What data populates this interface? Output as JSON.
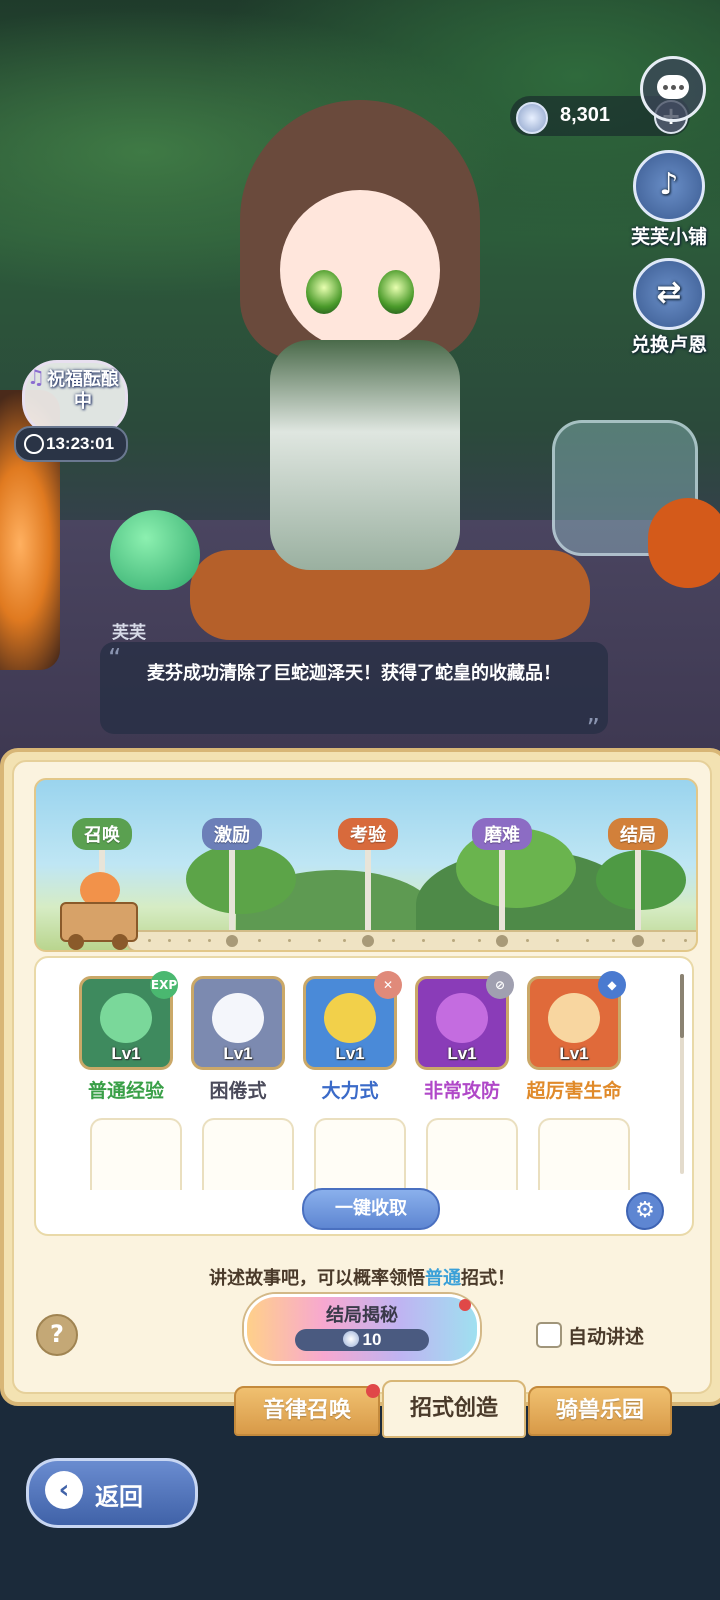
{
  "currency": {
    "amount": "8,301",
    "icon": "silver-coin-icon",
    "plus": "+"
  },
  "side_buttons": [
    {
      "label": "芙芙小铺",
      "icon": "lyre-icon"
    },
    {
      "label": "兑换卢恩",
      "icon": "exchange-icon"
    }
  ],
  "blessing": {
    "label": "祝福酝酿中",
    "timer": "13:23:01"
  },
  "dialog": {
    "speaker": "芙芙",
    "text": "麦芬成功清除了巨蛇迦泽天！获得了蛇皇的收藏品！"
  },
  "stages": [
    {
      "label": "召唤",
      "color": "#5aa050"
    },
    {
      "label": "激励",
      "color": "#6c7fb8"
    },
    {
      "label": "考验",
      "color": "#d86a3c"
    },
    {
      "label": "磨难",
      "color": "#8c6cc4"
    },
    {
      "label": "结局",
      "color": "#d2803a"
    }
  ],
  "skills": [
    {
      "level": "Lv1",
      "name": "普通经验",
      "name_color": "#3aa048",
      "bg": "#3e8a5e",
      "badge": "EXP",
      "badge_color": "#4ab870"
    },
    {
      "level": "Lv1",
      "name": "困倦式",
      "name_color": "#4a4a5a",
      "bg": "#7c8ab0",
      "badge": "",
      "badge_color": ""
    },
    {
      "level": "Lv1",
      "name": "大力式",
      "name_color": "#3a6ac8",
      "bg": "#4a8ad8",
      "badge": "✕",
      "badge_color": "#e08a7a"
    },
    {
      "level": "Lv1",
      "name": "非常攻防",
      "name_color": "#b048c8",
      "bg": "#8a3cb8",
      "badge": "⊘",
      "badge_color": "#a0a0b0"
    },
    {
      "level": "Lv1",
      "name": "超厉害生命",
      "name_color": "#e08a2a",
      "bg": "#e06a3a",
      "badge": "◆",
      "badge_color": "#4a7ad0"
    }
  ],
  "collect_button": "一键收取",
  "hint": {
    "prefix": "讲述故事吧，可以概率领悟",
    "highlight": "普通",
    "suffix": "招式！"
  },
  "reveal": {
    "label": "结局揭秘",
    "cost": "10"
  },
  "auto_narrate": {
    "label": "自动讲述",
    "checked": false
  },
  "tabs": [
    {
      "label": "音律召唤",
      "active": false,
      "dot": true
    },
    {
      "label": "招式创造",
      "active": true,
      "dot": false
    },
    {
      "label": "骑兽乐园",
      "active": false,
      "dot": false
    }
  ],
  "back_button": "返回",
  "help_label": "?"
}
